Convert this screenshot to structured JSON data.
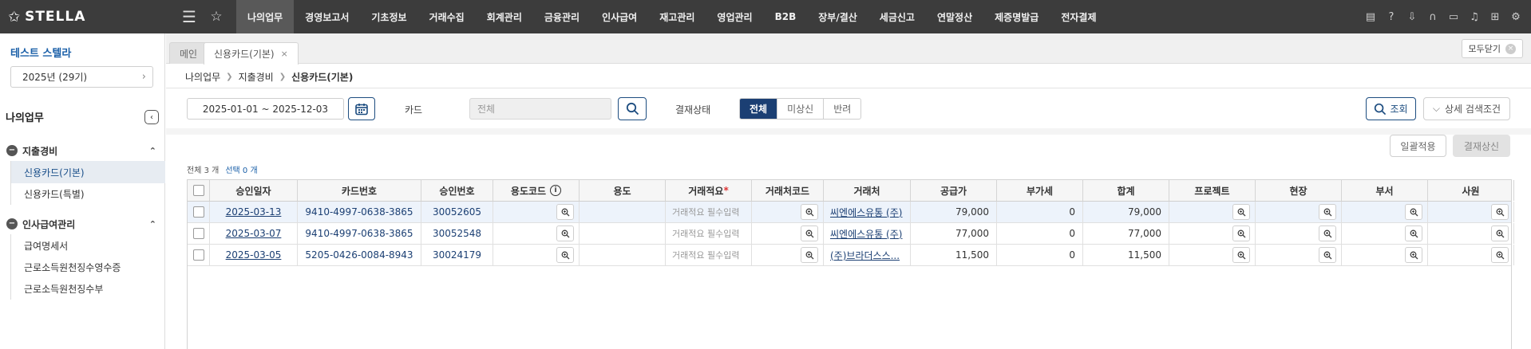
{
  "app": {
    "logo": "STELLA"
  },
  "nav": {
    "items": [
      "나의업무",
      "경영보고서",
      "기초정보",
      "거래수집",
      "회계관리",
      "금융관리",
      "인사급여",
      "재고관리",
      "영업관리",
      "B2B",
      "장부/결산",
      "세금신고",
      "연말정산",
      "제증명발급",
      "전자결제"
    ],
    "active_index": 0,
    "util_icons": [
      "clipboard-icon",
      "help-icon",
      "download-icon",
      "headset-icon",
      "chat-icon",
      "bell-icon",
      "org-chart-icon",
      "settings-icon"
    ]
  },
  "sidebar": {
    "company": "테스트 스텔라",
    "period": "2025년 (29기)",
    "title": "나의업무",
    "groups": [
      {
        "label": "지출경비",
        "items": [
          "신용카드(기본)",
          "신용카드(특별)"
        ],
        "active": 0
      },
      {
        "label": "인사급여관리",
        "items": [
          "급여명세서",
          "근로소득원천징수영수증",
          "근로소득원천징수부"
        ]
      }
    ]
  },
  "tabs": {
    "items": [
      "메인",
      "신용카드(기본)"
    ],
    "active": 1,
    "close_all": "모두닫기"
  },
  "breadcrumb": [
    "나의업무",
    "지출경비",
    "신용카드(기본)"
  ],
  "search": {
    "date_range": "2025-01-01 ~ 2025-12-03",
    "card_label": "카드",
    "card_placeholder": "전체",
    "status_label": "결재상태",
    "status_options": [
      "전체",
      "미상신",
      "반려"
    ],
    "status_selected": 0,
    "query_button": "조회",
    "advanced_button": "상세 검색조건"
  },
  "actions": {
    "apply": "일괄적용",
    "submit": "결재상신"
  },
  "counts": {
    "total": "전체 3 개",
    "selected": "선택 0 개"
  },
  "table": {
    "columns": [
      "승인일자",
      "카드번호",
      "승인번호",
      "용도코드",
      "용도",
      "거래적요",
      "거래처코드",
      "거래처",
      "공급가",
      "부가세",
      "합계",
      "프로젝트",
      "현장",
      "부서",
      "사원"
    ],
    "required_mark": "*",
    "rows": [
      {
        "date": "2025-03-13",
        "card": "9410-4997-0638-3865",
        "approval": "30052605",
        "usage_code": "",
        "usage": "",
        "memo": "거래적요 필수입력",
        "vendor_code": "",
        "vendor": "씨엔에스유통 (주)",
        "supply": "79,000",
        "vat": "0",
        "total": "79,000"
      },
      {
        "date": "2025-03-07",
        "card": "9410-4997-0638-3865",
        "approval": "30052548",
        "usage_code": "",
        "usage": "",
        "memo": "거래적요 필수입력",
        "vendor_code": "",
        "vendor": "씨엔에스유통 (주)",
        "supply": "77,000",
        "vat": "0",
        "total": "77,000"
      },
      {
        "date": "2025-03-05",
        "card": "5205-0426-0084-8943",
        "approval": "30024179",
        "usage_code": "",
        "usage": "",
        "memo": "거래적요 필수입력",
        "vendor_code": "",
        "vendor": "(주)브라더스스...",
        "supply": "11,500",
        "vat": "0",
        "total": "11,500"
      }
    ]
  },
  "colors": {
    "topbar": "#3c3c3c",
    "accent": "#1b3f73",
    "link": "#1a5fa8"
  }
}
